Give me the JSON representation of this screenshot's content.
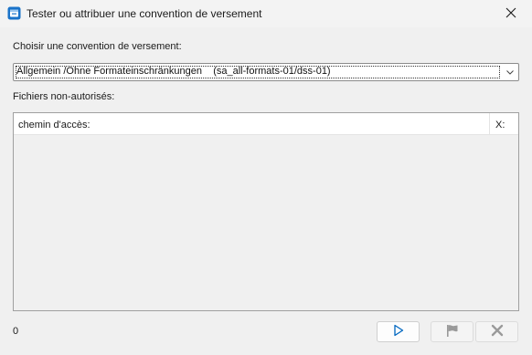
{
  "window": {
    "title": "Tester ou attribuer une convention de versement"
  },
  "form": {
    "choose_label": "Choisir une convention de versement:",
    "selected_convention": "Allgemein /Ohne Formateinschränkungen    (sa_all-formats-01/dss-01)",
    "files_label": "Fichiers non-autorisés:"
  },
  "table": {
    "columns": [
      "chemin d'accès:",
      "X:"
    ],
    "rows": []
  },
  "footer": {
    "count": "0"
  },
  "icons": {
    "app": "app-window-icon",
    "close": "close-icon",
    "dropdown": "chevron-down-icon",
    "play": "play-icon",
    "flag": "flag-icon",
    "cancel": "x-icon"
  },
  "colors": {
    "accent": "#0067c0",
    "disabled": "#9a9a9a"
  }
}
